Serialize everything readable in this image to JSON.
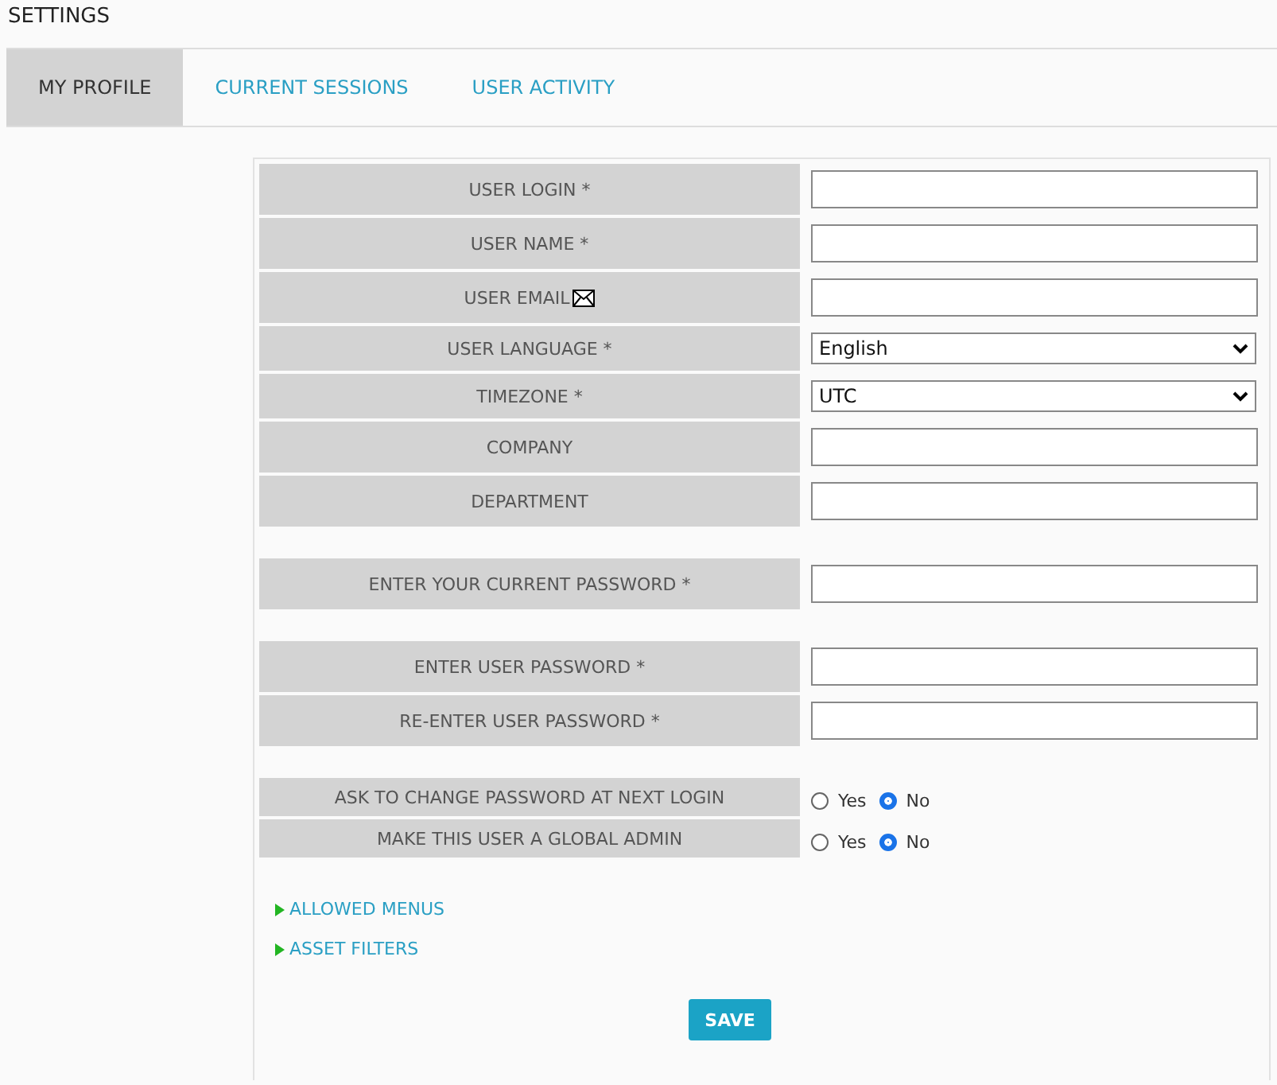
{
  "page_title": "SETTINGS",
  "tabs": [
    {
      "label": "MY PROFILE",
      "selected": true
    },
    {
      "label": "CURRENT SESSIONS",
      "selected": false
    },
    {
      "label": "USER ACTIVITY",
      "selected": false
    }
  ],
  "form_groups": [
    [
      {
        "label": "USER LOGIN *",
        "kind": "text"
      },
      {
        "label": "USER NAME *",
        "kind": "text"
      },
      {
        "label": "USER EMAIL",
        "kind": "email"
      },
      {
        "label": "USER LANGUAGE *",
        "kind": "select",
        "value": "English"
      },
      {
        "label": "TIMEZONE *",
        "kind": "select",
        "value": "UTC"
      },
      {
        "label": "COMPANY",
        "kind": "text"
      },
      {
        "label": "DEPARTMENT",
        "kind": "text"
      }
    ],
    [
      {
        "label": "ENTER YOUR CURRENT PASSWORD *",
        "kind": "text"
      }
    ],
    [
      {
        "label": "ENTER USER PASSWORD *",
        "kind": "text"
      },
      {
        "label": "RE-ENTER USER PASSWORD *",
        "kind": "text"
      }
    ],
    [
      {
        "label": "ASK TO CHANGE PASSWORD AT NEXT LOGIN",
        "kind": "radio",
        "options": [
          {
            "label": "Yes",
            "selected": false
          },
          {
            "label": "No",
            "selected": true
          }
        ]
      },
      {
        "label": "MAKE THIS USER A GLOBAL ADMIN",
        "kind": "radio",
        "options": [
          {
            "label": "Yes",
            "selected": false
          },
          {
            "label": "No",
            "selected": true
          }
        ]
      }
    ]
  ],
  "sections": [
    "ALLOWED MENUS",
    "ASSET FILTERS"
  ],
  "save_button": "SAVE"
}
